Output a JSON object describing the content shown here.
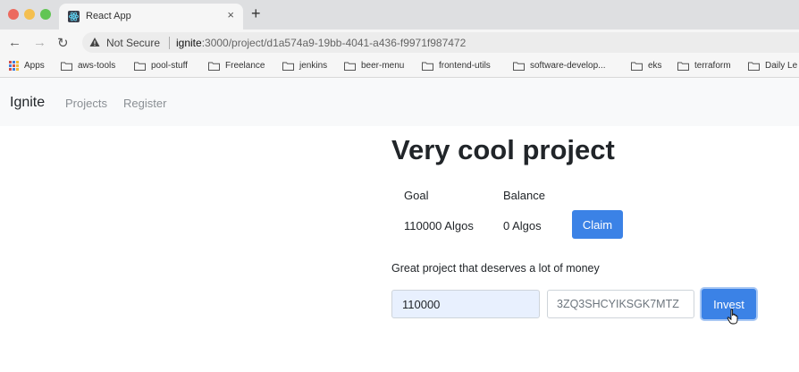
{
  "browser": {
    "tab_title": "React App",
    "tab_close": "×",
    "new_tab": "+",
    "not_secure": "Not Secure",
    "url_host": "ignite",
    "url_rest": ":3000/project/d1a574a9-19bb-4041-a436-f9971f987472",
    "back": "←",
    "forward": "→",
    "reload": "↻"
  },
  "bookmarks": [
    {
      "label": "Apps",
      "icon": "apps-grid-icon"
    },
    {
      "label": "aws-tools",
      "icon": "folder-icon"
    },
    {
      "label": "pool-stuff",
      "icon": "folder-icon"
    },
    {
      "label": "Freelance",
      "icon": "folder-icon"
    },
    {
      "label": "jenkins",
      "icon": "folder-icon"
    },
    {
      "label": "beer-menu",
      "icon": "folder-icon"
    },
    {
      "label": "frontend-utils",
      "icon": "folder-icon"
    },
    {
      "label": "software-develop...",
      "icon": "folder-icon"
    },
    {
      "label": "eks",
      "icon": "folder-icon"
    },
    {
      "label": "terraform",
      "icon": "folder-icon"
    },
    {
      "label": "Daily Le",
      "icon": "folder-icon"
    }
  ],
  "navbar": {
    "brand": "Ignite",
    "links": [
      "Projects",
      "Register"
    ]
  },
  "project": {
    "title": "Very cool project",
    "goal_label": "Goal",
    "balance_label": "Balance",
    "goal_value": "110000 Algos",
    "balance_value": "0 Algos",
    "claim_label": "Claim",
    "description": "Great project that deserves a lot of money",
    "amount_value": "110000",
    "address_value": "3ZQ3SHCYIKSGK7MTZ",
    "invest_label": "Invest"
  },
  "colors": {
    "primary": "#3b82e6",
    "navbar_bg": "#f8f9fa",
    "amount_input_bg": "#e8f0fe"
  }
}
